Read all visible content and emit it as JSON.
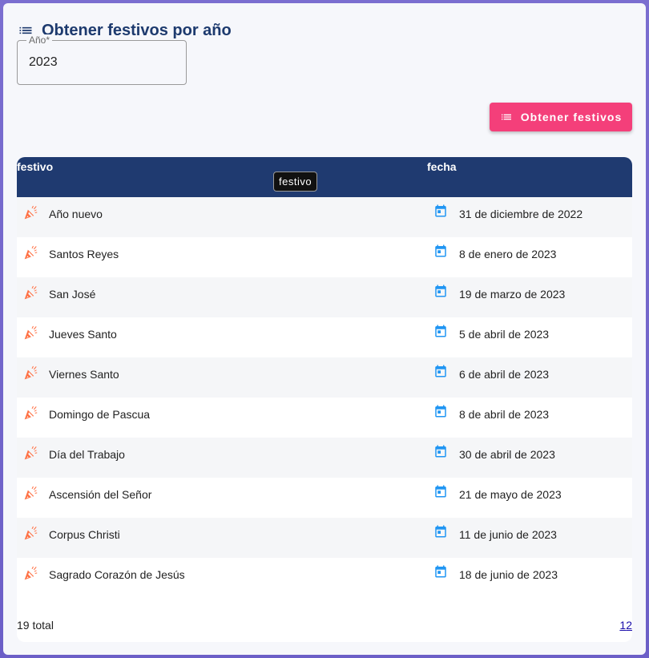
{
  "header": {
    "title": "Obtener festivos por año"
  },
  "form": {
    "year_label": "Año*",
    "year_value": "2023"
  },
  "toolbar": {
    "fetch_label": "Obtener festivos"
  },
  "table": {
    "columns": [
      "festivo",
      "fecha"
    ],
    "tooltip": "festivo",
    "rows": [
      {
        "festivo": "Año nuevo",
        "fecha": "31 de diciembre de 2022"
      },
      {
        "festivo": "Santos Reyes",
        "fecha": "8 de enero de 2023"
      },
      {
        "festivo": "San José",
        "fecha": "19 de marzo de 2023"
      },
      {
        "festivo": "Jueves Santo",
        "fecha": "5 de abril de 2023"
      },
      {
        "festivo": "Viernes Santo",
        "fecha": "6 de abril de 2023"
      },
      {
        "festivo": "Domingo de Pascua",
        "fecha": "8 de abril de 2023"
      },
      {
        "festivo": "Día del Trabajo",
        "fecha": "30 de abril de 2023"
      },
      {
        "festivo": "Ascensión del Señor",
        "fecha": "21 de mayo de 2023"
      },
      {
        "festivo": "Corpus Christi",
        "fecha": "11 de junio de 2023"
      },
      {
        "festivo": "Sagrado Corazón de Jesús",
        "fecha": "18 de junio de 2023"
      }
    ],
    "total_text": "19 total",
    "pages": [
      "1",
      "2"
    ]
  },
  "icons": {
    "title": "list-icon",
    "button": "list-icon",
    "holiday": "party-popper-icon",
    "date": "calendar-icon"
  },
  "colors": {
    "primary": "#1f3a70",
    "accent": "#f43f7a",
    "holiday_icon": "#ff7043",
    "calendar_icon": "#2196f3"
  }
}
